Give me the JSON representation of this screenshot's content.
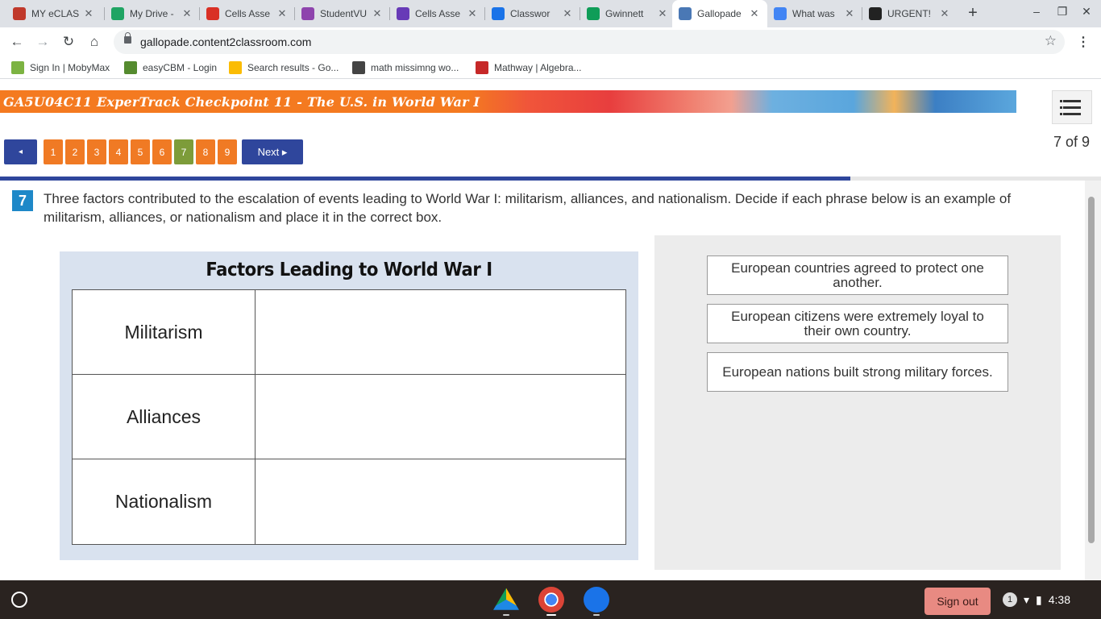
{
  "browser": {
    "tabs": [
      {
        "label": "MY eCLAS",
        "favicon_color": "#c0392b"
      },
      {
        "label": "My Drive -",
        "favicon_color": "#1fa463"
      },
      {
        "label": "Cells Asse",
        "favicon_color": "#d93025"
      },
      {
        "label": "StudentVU",
        "favicon_color": "#8e44ad"
      },
      {
        "label": "Cells Asse",
        "favicon_color": "#673ab7"
      },
      {
        "label": "Classwor",
        "favicon_color": "#1a73e8"
      },
      {
        "label": "Gwinnett",
        "favicon_color": "#0f9d58"
      },
      {
        "label": "Gallopade",
        "favicon_color": "#4a78b5"
      },
      {
        "label": "What was",
        "favicon_color": "#4285f4"
      },
      {
        "label": "URGENT!",
        "favicon_color": "#222222"
      }
    ],
    "active_tab": 7,
    "url": "gallopade.content2classroom.com",
    "bookmarks": [
      {
        "label": "Sign In | MobyMax",
        "icon_color": "#7cb342"
      },
      {
        "label": "easyCBM - Login",
        "icon_color": "#558b2f"
      },
      {
        "label": "Search results - Go...",
        "icon_color": "#fbbc04"
      },
      {
        "label": "math missimng wo...",
        "icon_color": "#444444"
      },
      {
        "label": "Mathway | Algebra...",
        "icon_color": "#c62828"
      }
    ]
  },
  "assessment": {
    "banner_title": "GA5U04C11 ExperTrack Checkpoint 11 - The U.S. in World War I",
    "pages": [
      "1",
      "2",
      "3",
      "4",
      "5",
      "6",
      "7",
      "8",
      "9"
    ],
    "current_page": 7,
    "prev_label": "◂",
    "next_label": "Next ▸",
    "counter": "7 of 9",
    "progress_fraction": 0.772,
    "question_number": "7",
    "question_text": "Three factors contributed to the escalation of events leading to World War I: militarism, alliances, and nationalism. Decide if each phrase below is an example of militarism, alliances, or nationalism and place it in the correct box.",
    "table_title": "Factors Leading to World War I",
    "categories": [
      "Militarism",
      "Alliances",
      "Nationalism"
    ],
    "answer_cards": [
      "European countries agreed to protect one another.",
      "European citizens were extremely loyal to their own country.",
      "European nations built strong military forces."
    ]
  },
  "shelf": {
    "sign_out_label": "Sign out",
    "notification_count": "1",
    "time": "4:38"
  }
}
